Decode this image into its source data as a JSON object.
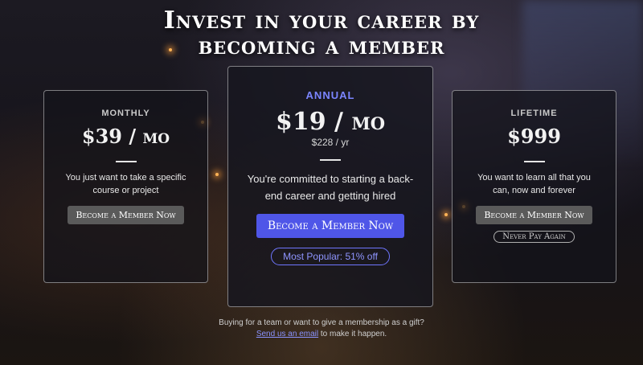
{
  "headline": {
    "line1": "Invest in your career by",
    "line2": "becoming a member"
  },
  "plans": {
    "monthly": {
      "name": "MONTHLY",
      "price": "$39 / mo",
      "description": "You just want to take a specific course or project",
      "button": "Become a Member Now"
    },
    "annual": {
      "name": "ANNUAL",
      "price": "$19 / mo",
      "sub_price": "$228 / yr",
      "description": "You're committed to starting a back-end career and getting hired",
      "button": "Become a Member Now",
      "badge": "Most Popular: 51% off"
    },
    "lifetime": {
      "name": "LIFETIME",
      "price": "$999",
      "description": "You want to learn all that you can, now and forever",
      "button": "Become a Member Now",
      "badge": "Never Pay Again"
    }
  },
  "footer": {
    "line1": "Buying for a team or want to give a membership as a gift?",
    "link": "Send us an email",
    "line2_suffix": " to make it happen."
  },
  "colors": {
    "accent": "#4f56e8",
    "accent_text": "#7b85ff"
  }
}
